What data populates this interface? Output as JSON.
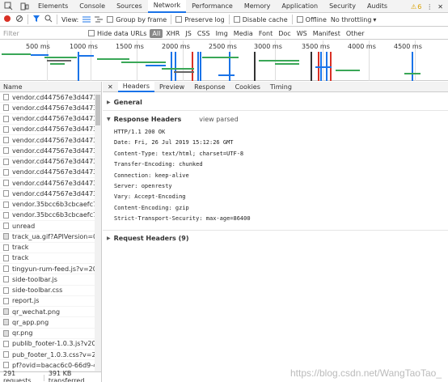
{
  "top_tabs": [
    "Elements",
    "Console",
    "Sources",
    "Network",
    "Performance",
    "Memory",
    "Application",
    "Security",
    "Audits"
  ],
  "active_tab": "Network",
  "warning_count": "6",
  "toolbar": {
    "view_label": "View:",
    "group_by_frame": "Group by frame",
    "preserve_log": "Preserve log",
    "disable_cache": "Disable cache",
    "offline": "Offline",
    "throttling": "No throttling"
  },
  "filter": {
    "placeholder": "Filter",
    "hide_data_urls": "Hide data URLs",
    "types": [
      "All",
      "XHR",
      "JS",
      "CSS",
      "Img",
      "Media",
      "Font",
      "Doc",
      "WS",
      "Manifest",
      "Other"
    ]
  },
  "timeline": {
    "ticks": [
      "500 ms",
      "1000 ms",
      "1500 ms",
      "2000 ms",
      "2500 ms",
      "3000 ms",
      "3500 ms",
      "4000 ms",
      "4500 ms"
    ]
  },
  "list": {
    "header": "Name",
    "rows": [
      "vendor.cd447567e3d4473591f",
      "vendor.cd447567e3d4473591f",
      "vendor.cd447567e3d4473591f",
      "vendor.cd447567e3d4473591f",
      "vendor.cd447567e3d4473591f",
      "vendor.cd447567e3d4473591f",
      "vendor.cd447567e3d4473591f",
      "vendor.cd447567e3d4473591f",
      "vendor.cd447567e3d4473591f",
      "vendor.cd447567e3d4473591f",
      "vendor.35bcc6b3cbcaefc7582",
      "vendor.35bcc6b3cbcaefc7582",
      "unread",
      "track_ua.gif?APIVersion=0.6.0..",
      "track",
      "track",
      "tingyun-rum-feed.js?v=20181..",
      "side-toolbar.js",
      "side-toolbar.css",
      "report.js",
      "qr_wechat.png",
      "qr_app.png",
      "qr.png",
      "publib_footer-1.0.3.js?v20180",
      "pub_footer_1.0.3.css?v=20181",
      "pf?ovid=bacac6c0-66d9-4b07"
    ]
  },
  "status": {
    "requests": "291 requests",
    "transferred": "391 KB transferred"
  },
  "detail_tabs": [
    "Headers",
    "Preview",
    "Response",
    "Cookies",
    "Timing"
  ],
  "detail_active": "Headers",
  "general_label": "General",
  "response_headers": {
    "title": "Response Headers",
    "view_parsed": "view parsed",
    "lines": [
      "HTTP/1.1 200 OK",
      "Date: Fri, 26 Jul 2019 15:12:26 GMT",
      "Content-Type: text/html; charset=UTF-8",
      "Transfer-Encoding: chunked",
      "Connection: keep-alive",
      "Server: openresty",
      "Vary: Accept-Encoding",
      "Content-Encoding: gzip",
      "Strict-Transport-Security: max-age=86400"
    ]
  },
  "request_headers_label": "Request Headers (9)",
  "watermark": "https://blog.csdn.net/WangTaoTao_"
}
